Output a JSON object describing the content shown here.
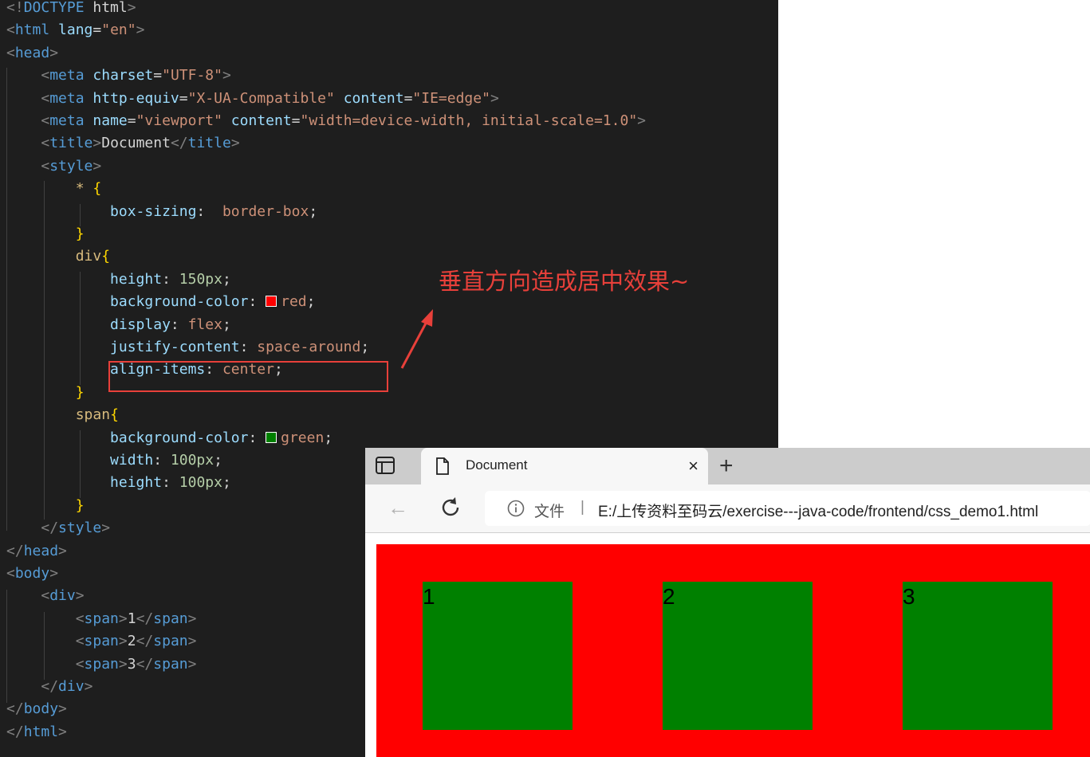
{
  "editor": {
    "lines": [
      [
        [
          "tg",
          "<!"
        ],
        [
          "tn",
          "DOCTYPE"
        ],
        [
          "tx",
          " html"
        ],
        [
          "tg",
          ">"
        ]
      ],
      [
        [
          "tg",
          "<"
        ],
        [
          "tn",
          "html"
        ],
        [
          "at",
          " lang"
        ],
        [
          "pn",
          "="
        ],
        [
          "st",
          "\"en\""
        ],
        [
          "tg",
          ">"
        ]
      ],
      [
        [
          "tg",
          "<"
        ],
        [
          "tn",
          "head"
        ],
        [
          "tg",
          ">"
        ]
      ],
      [
        [
          "tx",
          "    "
        ],
        [
          "tg",
          "<"
        ],
        [
          "tn",
          "meta"
        ],
        [
          "at",
          " charset"
        ],
        [
          "pn",
          "="
        ],
        [
          "st",
          "\"UTF-8\""
        ],
        [
          "tg",
          ">"
        ]
      ],
      [
        [
          "tx",
          "    "
        ],
        [
          "tg",
          "<"
        ],
        [
          "tn",
          "meta"
        ],
        [
          "at",
          " http-equiv"
        ],
        [
          "pn",
          "="
        ],
        [
          "st",
          "\"X-UA-Compatible\""
        ],
        [
          "at",
          " content"
        ],
        [
          "pn",
          "="
        ],
        [
          "st",
          "\"IE=edge\""
        ],
        [
          "tg",
          ">"
        ]
      ],
      [
        [
          "tx",
          "    "
        ],
        [
          "tg",
          "<"
        ],
        [
          "tn",
          "meta"
        ],
        [
          "at",
          " name"
        ],
        [
          "pn",
          "="
        ],
        [
          "st",
          "\"viewport\""
        ],
        [
          "at",
          " content"
        ],
        [
          "pn",
          "="
        ],
        [
          "st",
          "\"width=device-width, initial-scale=1.0\""
        ],
        [
          "tg",
          ">"
        ]
      ],
      [
        [
          "tx",
          "    "
        ],
        [
          "tg",
          "<"
        ],
        [
          "tn",
          "title"
        ],
        [
          "tg",
          ">"
        ],
        [
          "tx",
          "Document"
        ],
        [
          "tg",
          "</"
        ],
        [
          "tn",
          "title"
        ],
        [
          "tg",
          ">"
        ]
      ],
      [
        [
          "tx",
          "    "
        ],
        [
          "tg",
          "<"
        ],
        [
          "tn",
          "style"
        ],
        [
          "tg",
          ">"
        ]
      ],
      [
        [
          "tx",
          "        "
        ],
        [
          "sel",
          "* "
        ],
        [
          "br",
          "{"
        ]
      ],
      [
        [
          "tx",
          "            "
        ],
        [
          "pr",
          "box-sizing"
        ],
        [
          "pn",
          ":  "
        ],
        [
          "vl",
          "border-box"
        ],
        [
          "pn",
          ";"
        ]
      ],
      [
        [
          "tx",
          "        "
        ],
        [
          "br",
          "}"
        ]
      ],
      [
        [
          "tx",
          "        "
        ],
        [
          "sel",
          "div"
        ],
        [
          "br",
          "{"
        ]
      ],
      [
        [
          "tx",
          "            "
        ],
        [
          "pr",
          "height"
        ],
        [
          "pn",
          ": "
        ],
        [
          "nm",
          "150px"
        ],
        [
          "pn",
          ";"
        ]
      ],
      [
        [
          "tx",
          "            "
        ],
        [
          "pr",
          "background-color"
        ],
        [
          "pn",
          ": "
        ],
        [
          "swatch",
          "#ff0000"
        ],
        [
          "vl",
          "red"
        ],
        [
          "pn",
          ";"
        ]
      ],
      [
        [
          "tx",
          "            "
        ],
        [
          "pr",
          "display"
        ],
        [
          "pn",
          ": "
        ],
        [
          "vl",
          "flex"
        ],
        [
          "pn",
          ";"
        ]
      ],
      [
        [
          "tx",
          "            "
        ],
        [
          "pr",
          "justify-content"
        ],
        [
          "pn",
          ": "
        ],
        [
          "vl",
          "space-around"
        ],
        [
          "pn",
          ";"
        ]
      ],
      [
        [
          "tx",
          "            "
        ],
        [
          "pr",
          "align-items"
        ],
        [
          "pn",
          ": "
        ],
        [
          "vl",
          "center"
        ],
        [
          "pn",
          ";"
        ]
      ],
      [
        [
          "tx",
          "        "
        ],
        [
          "br",
          "}"
        ]
      ],
      [
        [
          "tx",
          "        "
        ],
        [
          "sel",
          "span"
        ],
        [
          "br",
          "{"
        ]
      ],
      [
        [
          "tx",
          "            "
        ],
        [
          "pr",
          "background-color"
        ],
        [
          "pn",
          ": "
        ],
        [
          "swatch",
          "#008000"
        ],
        [
          "vl",
          "green"
        ],
        [
          "pn",
          ";"
        ]
      ],
      [
        [
          "tx",
          "            "
        ],
        [
          "pr",
          "width"
        ],
        [
          "pn",
          ": "
        ],
        [
          "nm",
          "100px"
        ],
        [
          "pn",
          ";"
        ]
      ],
      [
        [
          "tx",
          "            "
        ],
        [
          "pr",
          "height"
        ],
        [
          "pn",
          ": "
        ],
        [
          "nm",
          "100px"
        ],
        [
          "pn",
          ";"
        ]
      ],
      [
        [
          "tx",
          "        "
        ],
        [
          "br",
          "}"
        ]
      ],
      [
        [
          "tx",
          "    "
        ],
        [
          "tg",
          "</"
        ],
        [
          "tn",
          "style"
        ],
        [
          "tg",
          ">"
        ]
      ],
      [
        [
          "tg",
          "</"
        ],
        [
          "tn",
          "head"
        ],
        [
          "tg",
          ">"
        ]
      ],
      [
        [
          "tg",
          "<"
        ],
        [
          "tn",
          "body"
        ],
        [
          "tg",
          ">"
        ]
      ],
      [
        [
          "tx",
          "    "
        ],
        [
          "tg",
          "<"
        ],
        [
          "tn",
          "div"
        ],
        [
          "tg",
          ">"
        ]
      ],
      [
        [
          "tx",
          "        "
        ],
        [
          "tg",
          "<"
        ],
        [
          "tn",
          "span"
        ],
        [
          "tg",
          ">"
        ],
        [
          "tx",
          "1"
        ],
        [
          "tg",
          "</"
        ],
        [
          "tn",
          "span"
        ],
        [
          "tg",
          ">"
        ]
      ],
      [
        [
          "tx",
          "        "
        ],
        [
          "tg",
          "<"
        ],
        [
          "tn",
          "span"
        ],
        [
          "tg",
          ">"
        ],
        [
          "tx",
          "2"
        ],
        [
          "tg",
          "</"
        ],
        [
          "tn",
          "span"
        ],
        [
          "tg",
          ">"
        ]
      ],
      [
        [
          "tx",
          "        "
        ],
        [
          "tg",
          "<"
        ],
        [
          "tn",
          "span"
        ],
        [
          "tg",
          ">"
        ],
        [
          "tx",
          "3"
        ],
        [
          "tg",
          "</"
        ],
        [
          "tn",
          "span"
        ],
        [
          "tg",
          ">"
        ]
      ],
      [
        [
          "tx",
          "    "
        ],
        [
          "tg",
          "</"
        ],
        [
          "tn",
          "div"
        ],
        [
          "tg",
          ">"
        ]
      ],
      [
        [
          "tg",
          "</"
        ],
        [
          "tn",
          "body"
        ],
        [
          "tg",
          ">"
        ]
      ],
      [
        [
          "tg",
          "</"
        ],
        [
          "tn",
          "html"
        ],
        [
          "tg",
          ">"
        ]
      ]
    ]
  },
  "annotation": {
    "text": "垂直方向造成居中效果~",
    "color": "#e8403a"
  },
  "browser": {
    "tab_title": "Document",
    "close_glyph": "×",
    "newtab_glyph": "+",
    "back_glyph": "←",
    "url_label": "文件",
    "url_separator": "|",
    "url": "E:/上传资料至码云/exercise---java-code/frontend/css_demo1.html",
    "icons": [
      "tab-actions-icon",
      "document-icon",
      "close-icon",
      "new-tab-icon",
      "back-icon",
      "reload-icon",
      "info-icon"
    ]
  },
  "rendered": {
    "container_color": "#ff0000",
    "item_color": "#008000",
    "spans": [
      "1",
      "2",
      "3"
    ]
  }
}
